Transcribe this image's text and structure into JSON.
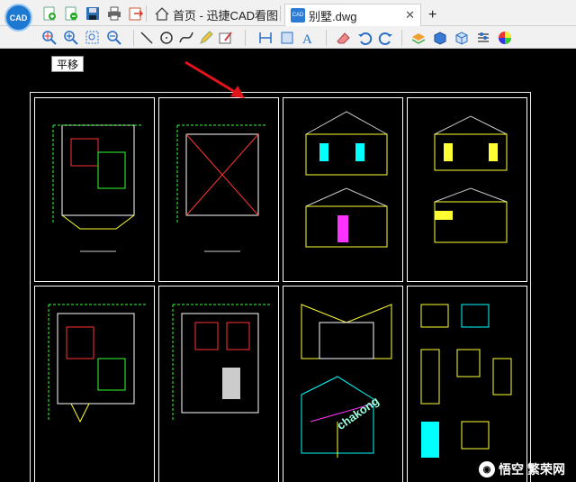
{
  "app": {
    "logo_text": "CAD"
  },
  "tabs": [
    {
      "label": "首页 - 迅捷CAD看图"
    },
    {
      "label": "别墅.dwg",
      "badge": "CAD"
    }
  ],
  "tab_new": "+",
  "tooltip": "平移",
  "overlay_text": "chakong",
  "watermark": {
    "text": "悟空",
    "brand": "繁荣网"
  },
  "colors": {
    "highlight": "#e1131b",
    "arrow": "#e1131b"
  }
}
